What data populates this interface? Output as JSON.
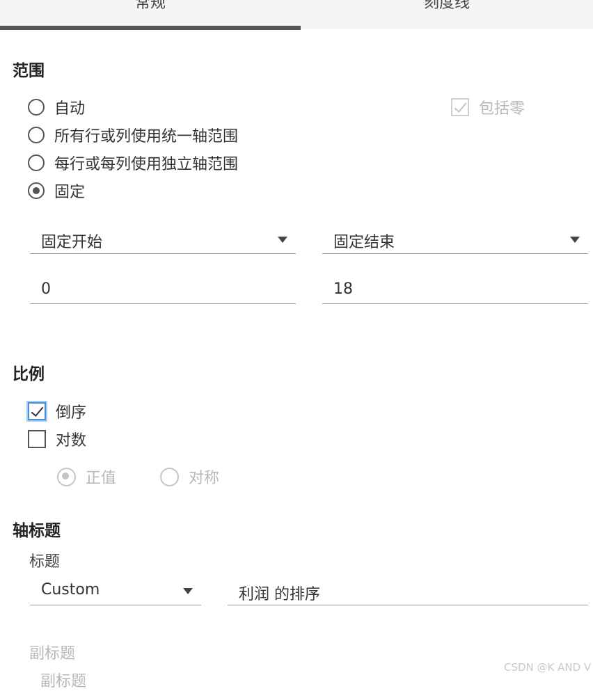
{
  "tabs": [
    {
      "label": "常规",
      "active": true
    },
    {
      "label": "刻度线",
      "active": false
    }
  ],
  "range": {
    "title": "范围",
    "options": [
      {
        "label": "自动",
        "selected": false
      },
      {
        "label": "所有行或列使用统一轴范围",
        "selected": false
      },
      {
        "label": "每行或每列使用独立轴范围",
        "selected": false
      },
      {
        "label": "固定",
        "selected": true
      }
    ],
    "include_zero": {
      "label": "包括零",
      "checked": true,
      "enabled": false
    },
    "fixed_start": {
      "label": "固定开始",
      "value": "0"
    },
    "fixed_end": {
      "label": "固定结束",
      "value": "18"
    }
  },
  "scale": {
    "title": "比例",
    "reversed": {
      "label": "倒序",
      "checked": true
    },
    "logarithmic": {
      "label": "对数",
      "checked": false
    },
    "positive": {
      "label": "正值",
      "selected": true,
      "enabled": false
    },
    "symmetric": {
      "label": "对称",
      "selected": false,
      "enabled": false
    }
  },
  "axis_title": {
    "title": "轴标题",
    "title_label": "标题",
    "title_mode": "Custom",
    "title_value": "利润 的排序",
    "subtitle_label": "副标题",
    "subtitle_value": "副标题"
  },
  "watermark": "CSDN @K AND V",
  "colors": {
    "accent_focus": "#4a8fd8",
    "tab_indicator": "#555555",
    "disabled": "#b8b8b8"
  }
}
